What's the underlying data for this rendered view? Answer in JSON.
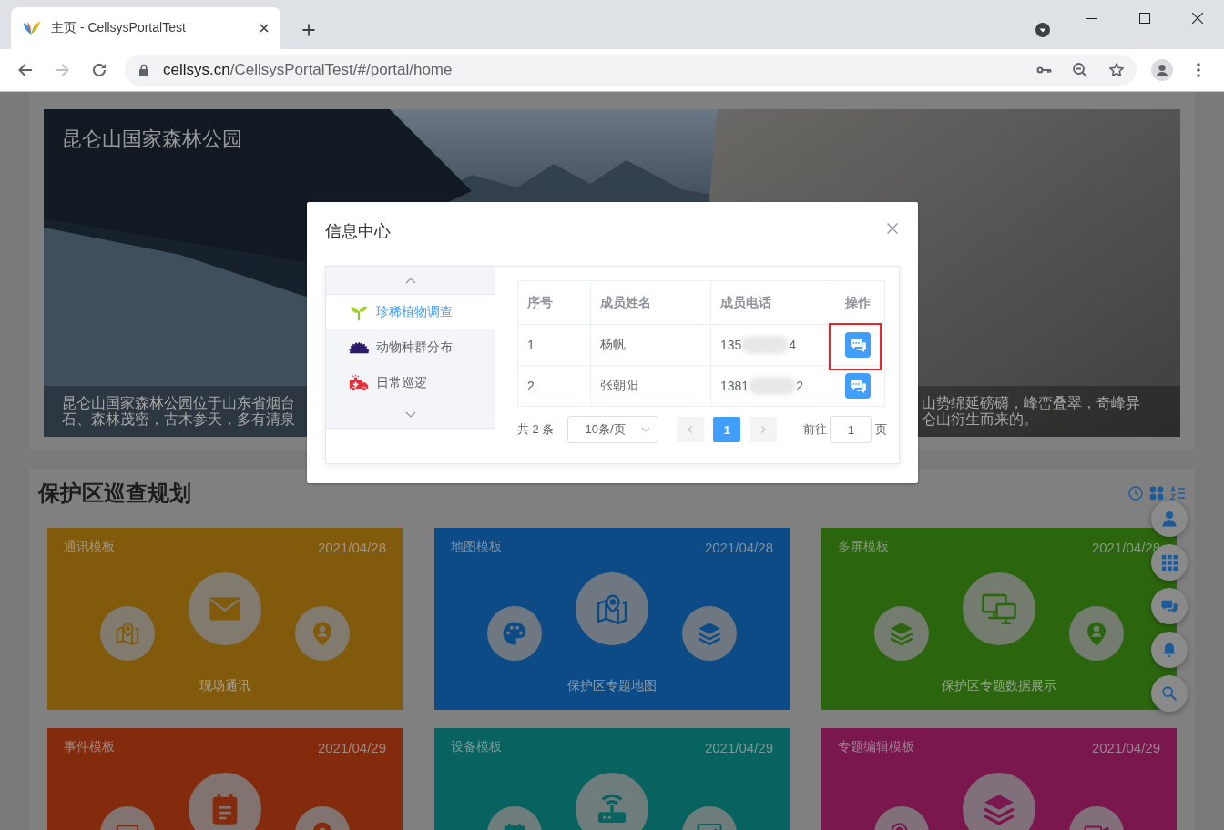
{
  "browser": {
    "tab": {
      "title": "主页 - CellsysPortalTest",
      "selected": true
    },
    "address": {
      "host": "cellsys.cn",
      "path": "/CellsysPortalTest/#/portal/home"
    },
    "forward_disabled": true
  },
  "banner": {
    "title": "昆仑山国家森林公园",
    "caption_left": [
      "昆仑山国家森林公园位于山东省烟台",
      "石、森林茂密，古木参天，多有清泉"
    ],
    "caption_right": [
      "山势绵延磅礴，峰峦叠翠，奇峰异",
      "仑山衍生而来的。"
    ]
  },
  "section": {
    "title": "保护区巡查规划"
  },
  "cards": [
    {
      "label": "通讯模板",
      "date": "2021/04/28",
      "name": "现场通讯",
      "color": "#825a0c"
    },
    {
      "label": "地图模板",
      "date": "2021/04/28",
      "name": "保护区专题地图",
      "color": "#0c4b86"
    },
    {
      "label": "多屏模板",
      "date": "2021/04/28",
      "name": "保护区专题数据展示",
      "color": "#2b660e"
    },
    {
      "label": "事件模板",
      "date": "2021/04/29",
      "color": "#842b0e"
    },
    {
      "label": "设备模板",
      "date": "2021/04/29",
      "color": "#086360"
    },
    {
      "label": "专题编辑模板",
      "date": "2021/04/29",
      "color": "#7a174f"
    }
  ],
  "dialog": {
    "title": "信息中心",
    "categories": [
      {
        "label": "珍稀植物调查",
        "selected": true
      },
      {
        "label": "动物种群分布",
        "selected": false
      },
      {
        "label": "日常巡逻",
        "selected": false
      }
    ],
    "table": {
      "columns": [
        "序号",
        "成员姓名",
        "成员电话",
        "操作"
      ],
      "rows": [
        {
          "index": "1",
          "name": "杨帆",
          "phone_start": "135",
          "phone_end": "4",
          "flagged": true
        },
        {
          "index": "2",
          "name": "张朝阳",
          "phone_start": "1381",
          "phone_end": "2",
          "flagged": false
        }
      ]
    },
    "pagination": {
      "total": "共 2 条",
      "page_size": "10条/页",
      "prev_disabled": true,
      "next_disabled": true,
      "pages": [
        {
          "label": "1",
          "selected": true
        }
      ],
      "goto_label": "前往",
      "goto_value": "1",
      "goto_unit": "页"
    }
  }
}
